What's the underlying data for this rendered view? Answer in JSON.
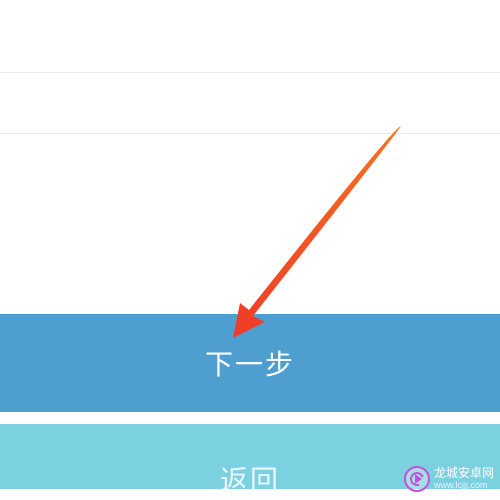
{
  "buttons": {
    "primary": "下一步",
    "secondary": "返回"
  },
  "watermark": {
    "name": "龙城安卓网",
    "url": "www.lcjjj.com"
  },
  "colors": {
    "primary_bg": "#4e9fcf",
    "secondary_bg": "#7bd1e0",
    "arrow": "#f04a24"
  }
}
